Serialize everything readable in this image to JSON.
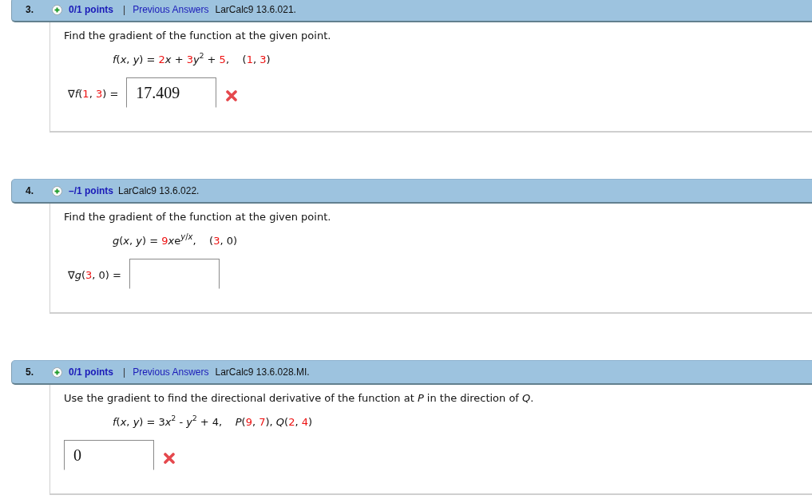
{
  "questions": [
    {
      "header": {
        "number": "3.",
        "points": "0/1 points",
        "separator": "|",
        "link": "Previous Answers",
        "source": "LarCalc9 13.6.021."
      },
      "prompt": "Find the gradient of the function at the given point.",
      "formula": [
        {
          "kind": "plain",
          "text": "*f*(*x*, *y*) = "
        },
        {
          "kind": "value",
          "text": "2"
        },
        {
          "kind": "plain",
          "text": "*x* + "
        },
        {
          "kind": "value",
          "text": "3"
        },
        {
          "kind": "plain",
          "text": "*y*$^{2}$ + "
        },
        {
          "kind": "value",
          "text": "5"
        },
        {
          "kind": "plain",
          "text": ",    ("
        },
        {
          "kind": "value",
          "text": "1"
        },
        {
          "kind": "plain",
          "text": ", "
        },
        {
          "kind": "value",
          "text": "3"
        },
        {
          "kind": "plain",
          "text": ")"
        }
      ],
      "answer": {
        "label": [
          {
            "kind": "plain",
            "text": "∇*f*("
          },
          {
            "kind": "value",
            "text": "1"
          },
          {
            "kind": "plain",
            "text": ", "
          },
          {
            "kind": "value",
            "text": "3"
          },
          {
            "kind": "plain",
            "text": ") ="
          }
        ],
        "value": "17.409",
        "correct": false
      }
    },
    {
      "header": {
        "number": "4.",
        "points": "–/1 points",
        "source": "LarCalc9 13.6.022."
      },
      "prompt": "Find the gradient of the function at the given point.",
      "formula": [
        {
          "kind": "plain",
          "text": "*g*(*x*, *y*) = "
        },
        {
          "kind": "value",
          "text": "9"
        },
        {
          "kind": "plain",
          "text": "*x*"
        },
        {
          "kind": "plain",
          "text": "e"
        },
        {
          "kind": "exponent",
          "text": "*y*/*x*"
        },
        {
          "kind": "plain",
          "text": ",    ("
        },
        {
          "kind": "value",
          "text": "3"
        },
        {
          "kind": "plain",
          "text": ", 0)"
        }
      ],
      "answer": {
        "label": [
          {
            "kind": "plain",
            "text": "∇*g*("
          },
          {
            "kind": "value",
            "text": "3"
          },
          {
            "kind": "plain",
            "text": ", 0) ="
          }
        ]
      }
    },
    {
      "header": {
        "number": "5.",
        "points": "0/1 points",
        "separator": "|",
        "link": "Previous Answers",
        "source": "LarCalc9 13.6.028.MI."
      },
      "prompt": "Use the gradient to find the directional derivative of the function at *P* in the direction of *Q*.",
      "formula": [
        {
          "kind": "plain",
          "text": "*f*(*x*, *y*) = 3"
        },
        {
          "kind": "plain",
          "text": "*x*$^{2}$ - *y*$^{2}$ + 4,    *P*("
        },
        {
          "kind": "value",
          "text": "9"
        },
        {
          "kind": "plain",
          "text": ", "
        },
        {
          "kind": "value",
          "text": "7"
        },
        {
          "kind": "plain",
          "text": "), *Q*("
        },
        {
          "kind": "value",
          "text": "2"
        },
        {
          "kind": "plain",
          "text": ", "
        },
        {
          "kind": "value",
          "text": "4"
        },
        {
          "kind": "plain",
          "text": ")"
        }
      ],
      "answer": {
        "value": "0",
        "correct": false
      }
    }
  ]
}
